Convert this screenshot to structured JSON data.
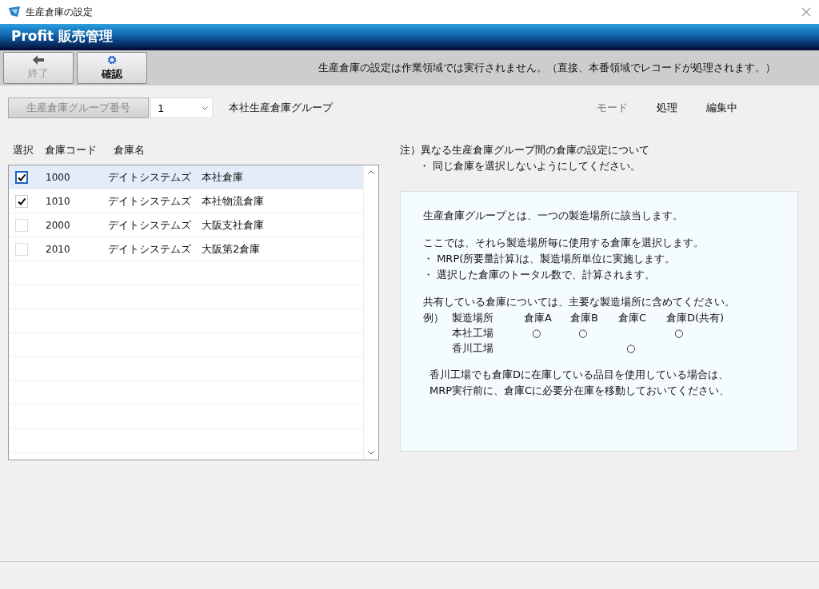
{
  "window": {
    "title": "生産倉庫の設定"
  },
  "header": {
    "title": "Profit 販売管理"
  },
  "toolbar": {
    "buttons": [
      {
        "label": "終了",
        "kind": "back",
        "disabled": true
      },
      {
        "label": "確認",
        "kind": "gear",
        "disabled": false
      }
    ],
    "message": "生産倉庫の設定は作業領域では実行されません。（直接、本番領域でレコードが処理されます。）"
  },
  "group": {
    "button": "生産倉庫グループ番号",
    "value": "1",
    "name": "本社生産倉庫グループ",
    "mode_label": "モード",
    "mode_action": "処理",
    "mode_state": "編集中"
  },
  "table": {
    "columns": [
      "選択",
      "倉庫コード",
      "倉庫名"
    ],
    "rows": [
      {
        "checked": true,
        "selected": true,
        "code": "1000",
        "name": "デイトシステムズ　本社倉庫"
      },
      {
        "checked": true,
        "selected": false,
        "code": "1010",
        "name": "デイトシステムズ　本社物流倉庫"
      },
      {
        "checked": false,
        "selected": false,
        "code": "2000",
        "name": "デイトシステムズ　大阪支社倉庫"
      },
      {
        "checked": false,
        "selected": false,
        "code": "2010",
        "name": "デイトシステムズ　大阪第2倉庫"
      }
    ]
  },
  "note": {
    "title": "注）異なる生産倉庫グループ間の倉庫の設定について",
    "bullet": "・ 同じ倉庫を選択しないようにしてください。"
  },
  "info": {
    "intro": "生産倉庫グループとは、一つの製造場所に該当します。",
    "lines": [
      "ここでは、それら製造場所毎に使用する倉庫を選択します。",
      "・ MRP(所要量計算)は、製造場所単位に実施します。",
      "・ 選択した倉庫のトータル数で、計算されます。"
    ],
    "shared": "共有している倉庫については、主要な製造場所に含めてください。",
    "example": {
      "label": "例）",
      "header": [
        "製造場所",
        "倉庫A",
        "倉庫B",
        "倉庫C",
        "倉庫D(共有)"
      ],
      "rows": [
        {
          "site": "本社工場",
          "cells": [
            "○",
            "○",
            null,
            "○"
          ]
        },
        {
          "site": "香川工場",
          "cells": [
            null,
            null,
            "○",
            null
          ]
        }
      ]
    },
    "footer": [
      "香川工場でも倉庫Dに在庫している品目を使用している場合は、",
      "MRP実行前に、倉庫Cに必要分在庫を移動しておいてください、"
    ]
  }
}
